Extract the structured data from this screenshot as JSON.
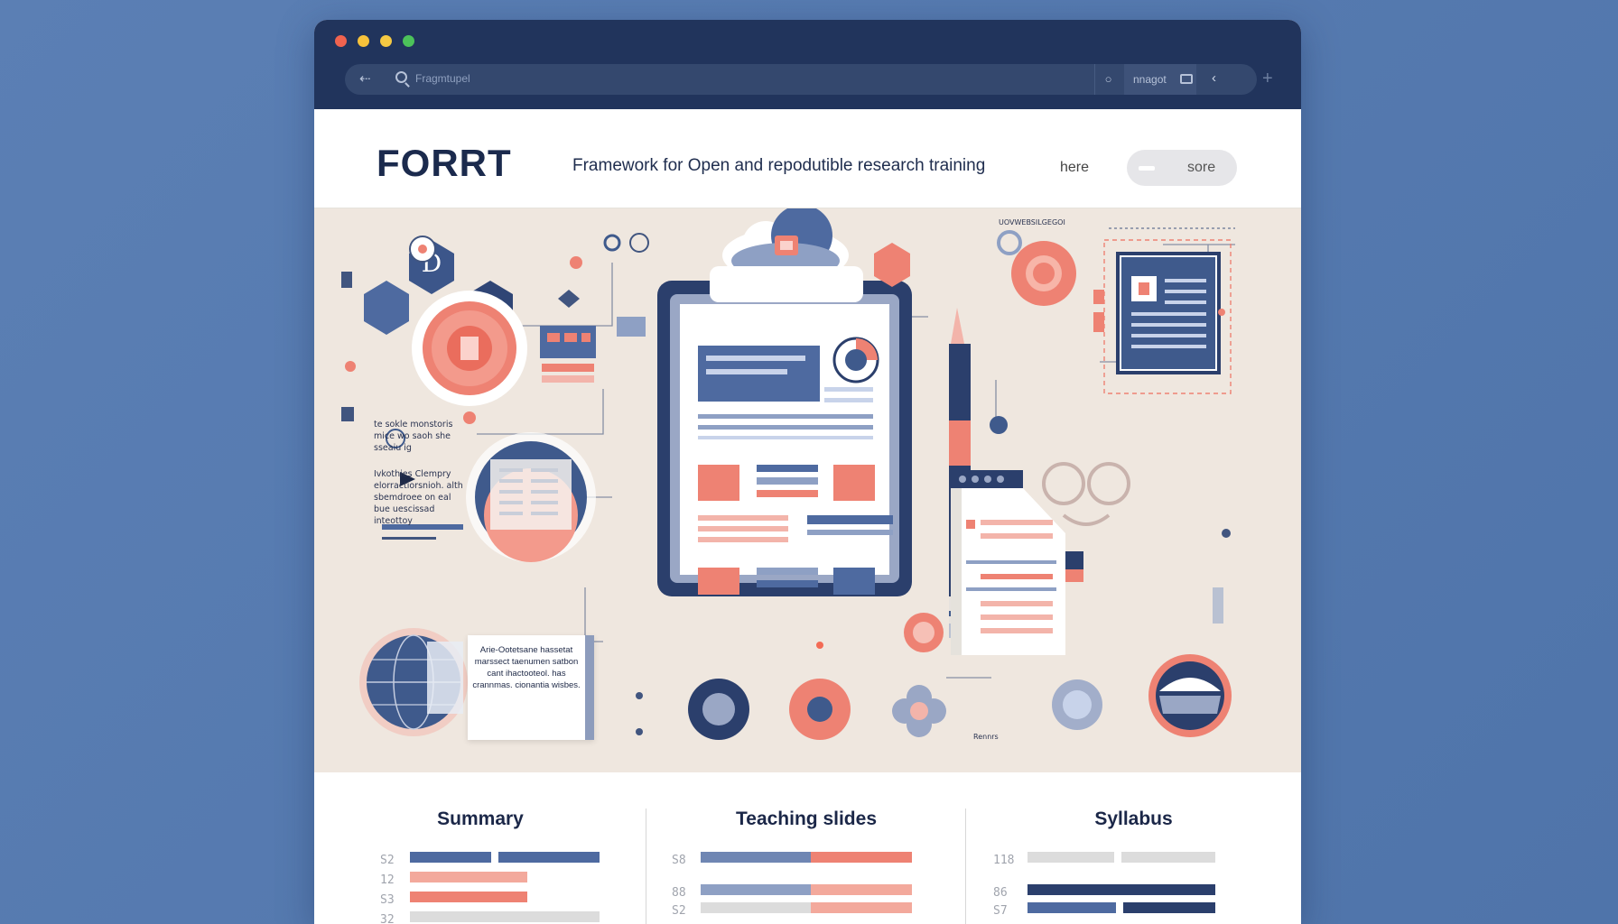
{
  "browser": {
    "url": "Fragmtupel",
    "extension_label": "nnagot",
    "back_icon": "back-arrow-icon",
    "plus_icon": "plus-icon"
  },
  "header": {
    "logo": "FORRT",
    "tagline": "Framework for Open and repodutible research training",
    "nav_link": "here",
    "nav_button": "sore"
  },
  "hero": {
    "caption_1": "te sokle monstoris mice wo saoh she sseaiu ig",
    "caption_2": "Ivkothies Clempry elorractiorsnioh. alth sbemdroee on eal bue uescissad inteottoy",
    "card_text": "Arie-Ootetsane hassetat marssect taenumen satbon cant ihactooteol. has crannmas. cionantia wisbes.",
    "right_heading": "UOVWEBSILGEGOI",
    "footnote": "Rennrs",
    "colors": {
      "navy": "#3f5a8c",
      "coral": "#ee8273",
      "cream": "#efe7df"
    }
  },
  "columns": [
    {
      "title": "Summary",
      "rows": [
        {
          "num": "S2",
          "fill": 1.0
        },
        {
          "num": "12",
          "fill": 0.62
        },
        {
          "num": "S3",
          "fill": 0.62
        },
        {
          "num": "32",
          "fill": 1.0
        }
      ]
    },
    {
      "title": "Teaching slides",
      "rows": [
        {
          "num": "S8",
          "fill": 1.0
        },
        {
          "num": "88",
          "fill": 1.0
        },
        {
          "num": "S2",
          "fill": 1.0
        }
      ]
    },
    {
      "title": "Syllabus",
      "rows": [
        {
          "num": "118",
          "fill": 1.0
        },
        {
          "num": "86",
          "fill": 1.0
        },
        {
          "num": "S7",
          "fill": 1.0
        }
      ]
    }
  ]
}
